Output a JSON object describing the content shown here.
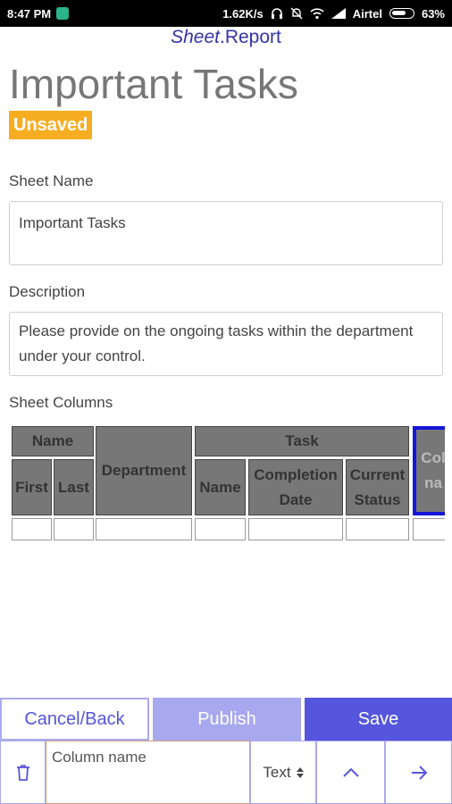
{
  "status_bar": {
    "time": "8:47 PM",
    "speed": "1.62K/s",
    "carrier": "Airtel",
    "battery": "63%"
  },
  "brand": {
    "part1": "Sheet",
    "part2": ".Report"
  },
  "page": {
    "title": "Important Tasks",
    "status_badge": "Unsaved"
  },
  "form": {
    "sheet_name_label": "Sheet Name",
    "sheet_name_value": "Important Tasks",
    "description_label": "Description",
    "description_value": "Please provide on the ongoing tasks within the department under your control.",
    "columns_label": "Sheet Columns"
  },
  "sheet": {
    "groups": {
      "name": "Name",
      "task": "Task"
    },
    "headers": {
      "first": "First",
      "last": "Last",
      "department": "Department",
      "task_name": "Name",
      "completion_date": "Completion Date",
      "current_status": "Current Status",
      "selected_partial": "Col na"
    }
  },
  "actions": {
    "cancel": "Cancel/Back",
    "publish": "Publish",
    "save": "Save"
  },
  "editor": {
    "column_name_placeholder": "Column name",
    "type_value": "Text",
    "icons": {
      "delete": "trash-icon",
      "up": "chevron-up-icon",
      "next": "arrow-right-icon"
    }
  },
  "colors": {
    "accent": "#5555dd",
    "accent_light": "#a8a8ee",
    "badge": "#f7ad21",
    "header_cell": "#777777",
    "selected_border": "#1515d8"
  }
}
